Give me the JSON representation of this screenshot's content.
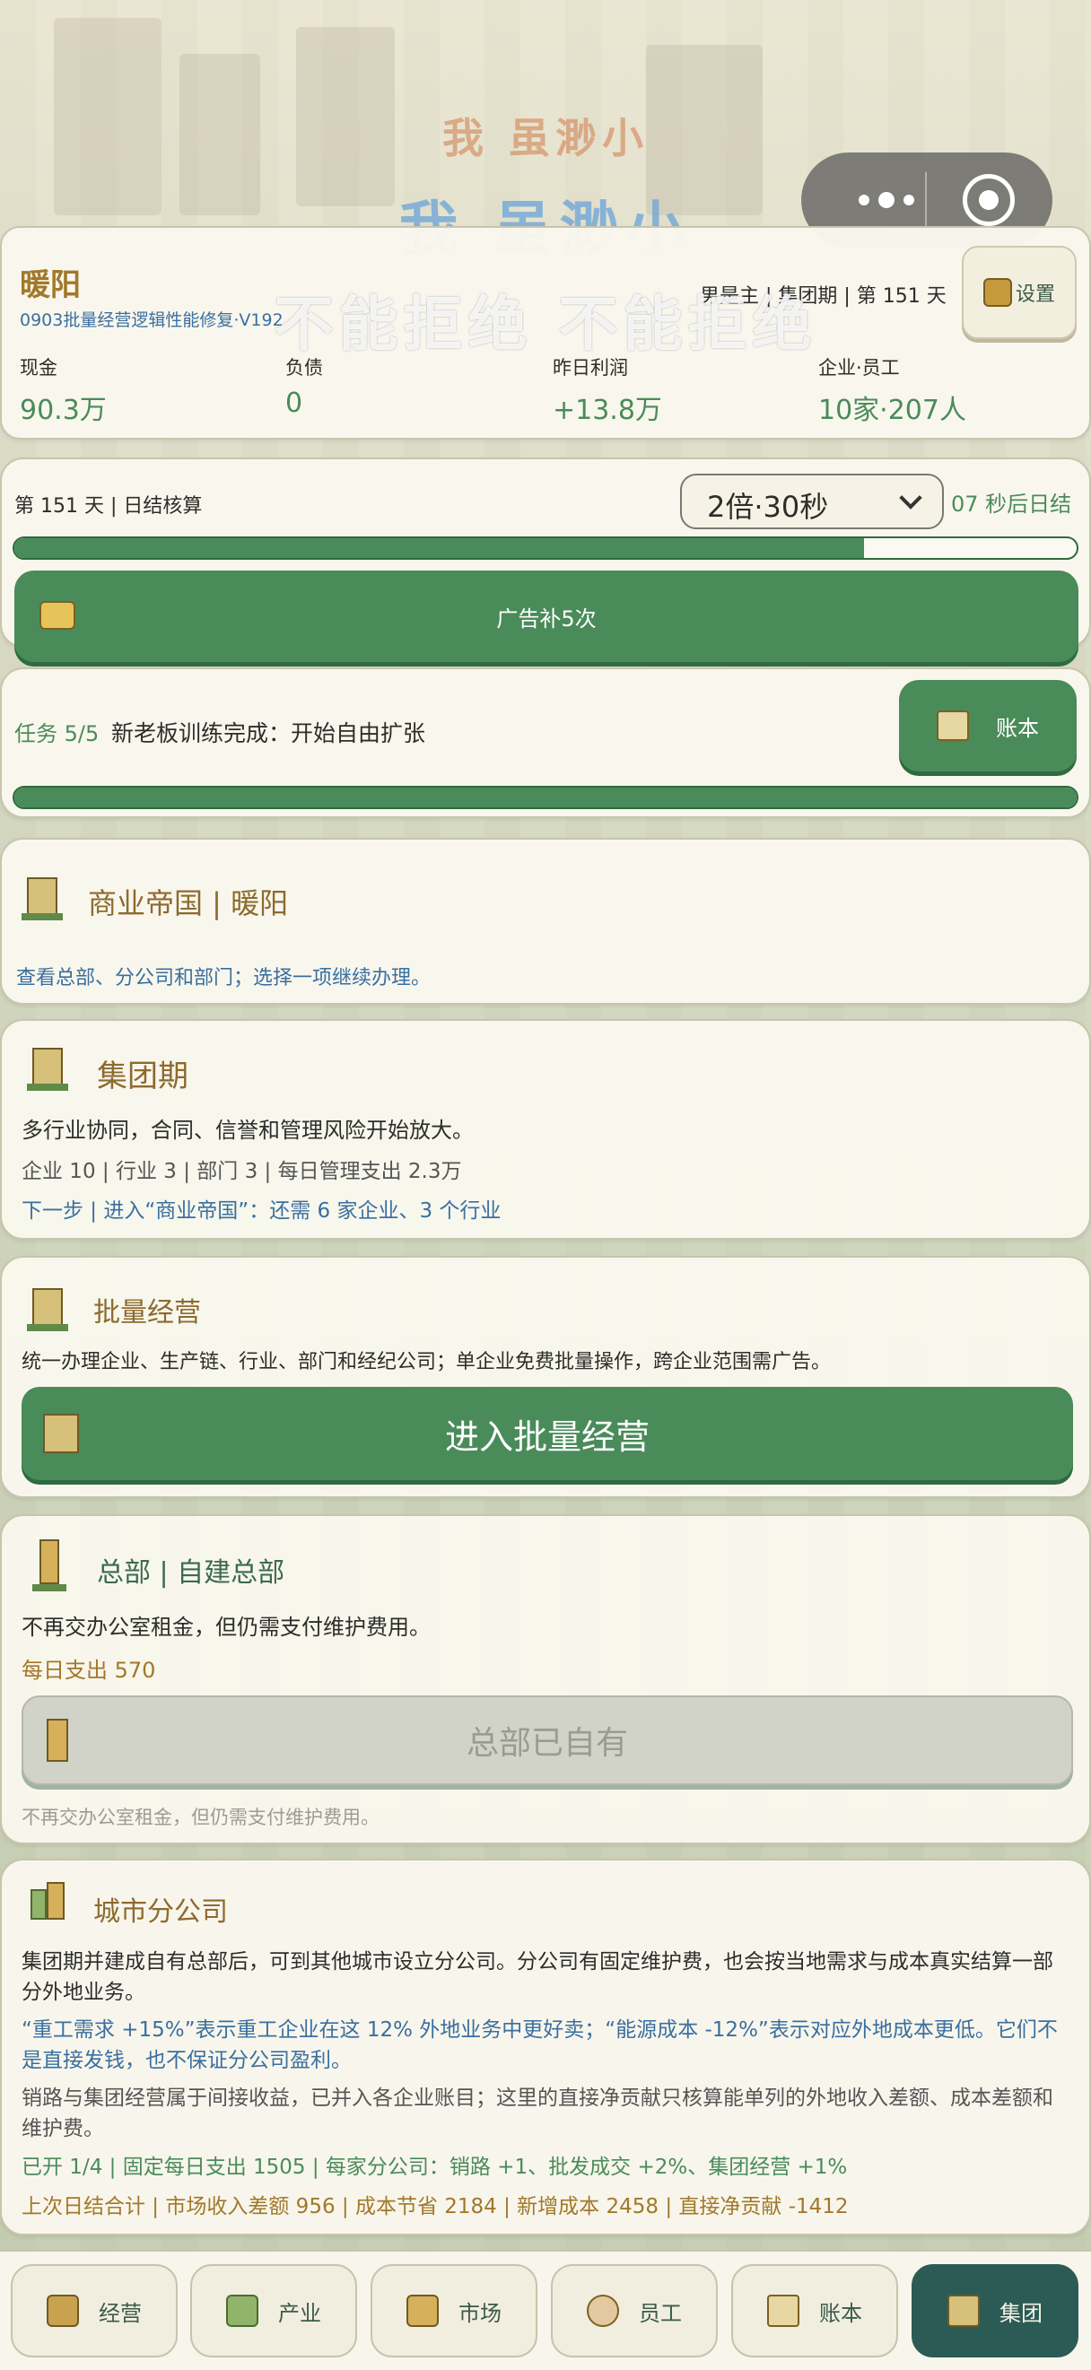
{
  "watermark": {
    "line_top": "我 虽渺小",
    "line_mid": "我 虽渺小",
    "line_overlay": "不能拒绝 不能拒绝"
  },
  "header": {
    "city": "暖阳",
    "version": "0903批量经营逻辑性能修复·V192",
    "status": "男是主 | 集团期 | 第 151 天",
    "settings_label": "设置",
    "stats": [
      {
        "label": "现金",
        "value": "90.3万"
      },
      {
        "label": "负债",
        "value": "0"
      },
      {
        "label": "昨日利润",
        "value": "+13.8万"
      },
      {
        "label": "企业·员工",
        "value": "10家·207人"
      }
    ]
  },
  "timer": {
    "day_label": "第 151 天 | 日结核算",
    "speed_select": "2倍·30秒",
    "countdown": "07 秒后日结",
    "progress": 0.8,
    "ad_button": "广告补5次"
  },
  "task": {
    "tag": "任务 5/5",
    "text": "新老板训练完成：开始自由扩张",
    "ledger_button": "账本",
    "progress": 1.0
  },
  "empire": {
    "title": "商业帝国 | 暖阳",
    "desc": "查看总部、分公司和部门；选择一项继续办理。"
  },
  "group_stage": {
    "title": "集团期",
    "desc": "多行业协同，合同、信誉和管理风险开始放大。",
    "stats": "企业 10 | 行业 3 | 部门 3 | 每日管理支出 2.3万",
    "next": "下一步 | 进入“商业帝国”：还需 6 家企业、3 个行业"
  },
  "batch": {
    "title": "批量经营",
    "desc": "统一办理企业、生产链、行业、部门和经纪公司；单企业免费批量操作，跨企业范围需广告。",
    "button": "进入批量经营"
  },
  "hq": {
    "title": "总部 | 自建总部",
    "desc": "不再交办公室租金，但仍需支付维护费用。",
    "daily": "每日支出 570",
    "button": "总部已自有",
    "note": "不再交办公室租金，但仍需支付维护费用。"
  },
  "branch": {
    "title": "城市分公司",
    "p1": "集团期并建成自有总部后，可到其他城市设立分公司。分公司有固定维护费，也会按当地需求与成本真实结算一部分外地业务。",
    "p2": "“重工需求 +15%”表示重工企业在这 12% 外地业务中更好卖；“能源成本 -12%”表示对应外地成本更低。它们不是直接发钱，也不保证分公司盈利。",
    "p3": "销路与集团经营属于间接收益，已并入各企业账目；这里的直接净贡献只核算能单列的外地收入差额、成本差额和维护费。",
    "p4": "已开 1/4 | 固定每日支出 1505 | 每家分公司：销路 +1、批发成交 +2%、集团经营 +1%",
    "p5": "上次日结合计 | 市场收入差额 956 | 成本节省 2184 | 新增成本 2458 | 直接净贡献 -1412"
  },
  "tabs": [
    {
      "label": "经营",
      "icon": "shop-icon"
    },
    {
      "label": "产业",
      "icon": "factory-icon"
    },
    {
      "label": "市场",
      "icon": "market-icon"
    },
    {
      "label": "员工",
      "icon": "staff-icon"
    },
    {
      "label": "账本",
      "icon": "ledger-icon"
    },
    {
      "label": "集团",
      "icon": "group-icon"
    }
  ],
  "colors": {
    "accent_green": "#4a8b5a",
    "active_tab": "#2c5b55",
    "gold_text": "#a2782a",
    "blue_text": "#3a6fa0"
  }
}
